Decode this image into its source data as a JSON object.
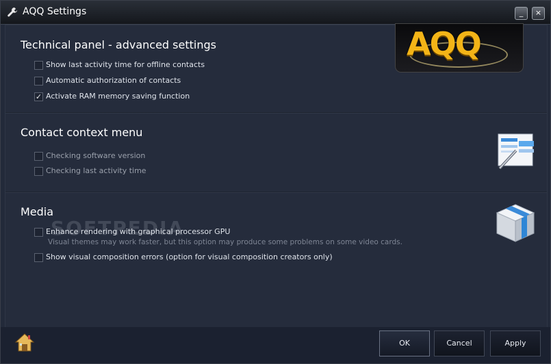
{
  "window": {
    "title": "AQQ Settings",
    "minimize_label": "_",
    "close_label": "×"
  },
  "logo": {
    "text": "AQQ"
  },
  "sections": [
    {
      "title": "Technical panel - advanced settings",
      "options": [
        {
          "label": "Show last activity time for offline contacts",
          "checked": false
        },
        {
          "label": "Automatic authorization of contacts",
          "checked": false
        },
        {
          "label": "Activate RAM memory saving function",
          "checked": true
        }
      ]
    },
    {
      "title": "Contact context menu",
      "options": [
        {
          "label": "Checking software version",
          "checked": false,
          "disabled": true
        },
        {
          "label": "Checking last activity time",
          "checked": false,
          "disabled": true
        }
      ]
    },
    {
      "title": "Media",
      "options": [
        {
          "label": "Enhance rendering with graphical processor GPU",
          "checked": false
        },
        {
          "label": "Show visual composition errors (option for visual composition creators only)",
          "checked": false
        }
      ],
      "hint": "Visual themes may work faster, but this option may produce some problems on some video cards."
    }
  ],
  "watermark": "SOFTPEDIA",
  "footer": {
    "ok_label": "OK",
    "cancel_label": "Cancel",
    "apply_label": "Apply"
  },
  "icons": {
    "title": "wrench-icon",
    "contact_menu": "list-pencil-icon",
    "media": "cube-icon",
    "home": "home-icon"
  },
  "colors": {
    "background": "#232a3a",
    "logo_gold": "#f3b417",
    "accent_blue": "#3a8ad8"
  }
}
